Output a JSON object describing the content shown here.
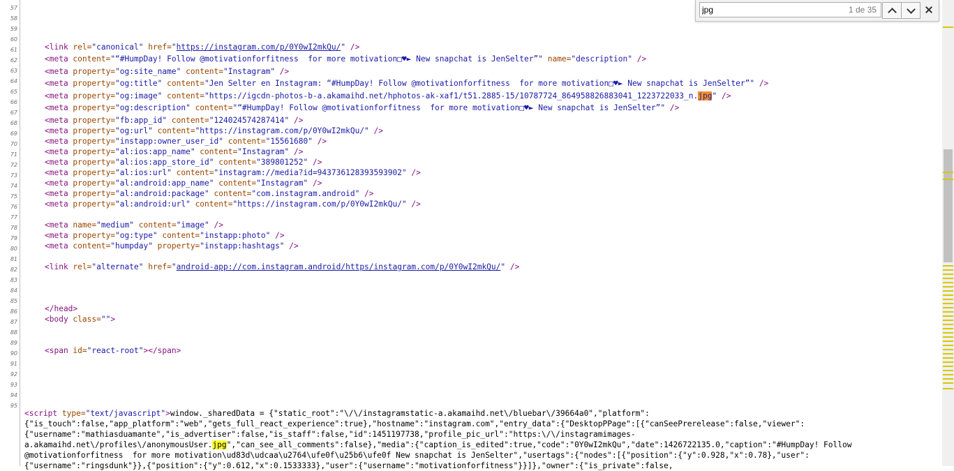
{
  "find_bar": {
    "query": "jpg",
    "count": "1 de 35"
  },
  "gutter": {
    "numbers": [
      "57",
      "58",
      "59",
      "60",
      "61",
      "62",
      "63",
      "64",
      "65",
      "66",
      "67",
      "68",
      "69",
      "70",
      "71",
      "72",
      "73",
      "74",
      "75",
      "76",
      "77",
      "78",
      "79",
      "80",
      "81",
      "82",
      "83",
      "84",
      "85",
      "86",
      "87",
      "88",
      "89",
      "90",
      "91",
      "92",
      "93",
      "94",
      "95"
    ]
  },
  "lines": {
    "l61": {
      "t1": "<link ",
      "a1": "rel=",
      "v1": "\"canonical\"",
      "a2": " href=",
      "v2a": "\"",
      "v2": "https://instagram.com/p/0Y0wI2mkQu/",
      "v2b": "\"",
      "t2": " />"
    },
    "l62": {
      "t1": "<meta ",
      "a1": "content=",
      "v1": "\"“#HumpDay! Follow @motivationforfitness  for more motivation□♥► New snapchat is JenSelter”\"",
      "a2": " name=",
      "v2": "\"description\"",
      "t2": " />"
    },
    "l63": {
      "t1": "<meta ",
      "a1": "property=",
      "v1": "\"og:site_name\"",
      "a2": " content=",
      "v2": "\"Instagram\"",
      "t2": " />"
    },
    "l64": {
      "t1": "<meta ",
      "a1": "property=",
      "v1": "\"og:title\"",
      "a2": " content=",
      "v2": "\"Jen Selter en Instagram: “#HumpDay! Follow @motivationforfitness  for more motivation□♥► New snapchat is JenSelter”\"",
      "t2": " />"
    },
    "l65": {
      "t1": "<meta ",
      "a1": "property=",
      "v1": "\"og:image\"",
      "a2": " content=",
      "v2": "\"https://igcdn-photos-b-a.akamaihd.net/hphotos-ak-xaf1/t51.2885-15/10787724_864958826883041_1223722033_n.",
      "hl": "jpg",
      "v2b": "\"",
      "t2": " />"
    },
    "l66": {
      "t1": "<meta ",
      "a1": "property=",
      "v1": "\"og:description\"",
      "a2": " content=",
      "v2": "\"“#HumpDay! Follow @motivationforfitness  for more motivation□♥► New snapchat is JenSelter”\"",
      "t2": " />"
    },
    "l67": {
      "t1": "<meta ",
      "a1": "property=",
      "v1": "\"fb:app_id\"",
      "a2": " content=",
      "v2": "\"124024574287414\"",
      "t2": " />"
    },
    "l68": {
      "t1": "<meta ",
      "a1": "property=",
      "v1": "\"og:url\"",
      "a2": " content=",
      "v2": "\"https://instagram.com/p/0Y0wI2mkQu/\"",
      "t2": " />"
    },
    "l69": {
      "t1": "<meta ",
      "a1": "property=",
      "v1": "\"instapp:owner_user_id\"",
      "a2": " content=",
      "v2": "\"15561680\"",
      "t2": " />"
    },
    "l70": {
      "t1": "<meta ",
      "a1": "property=",
      "v1": "\"al:ios:app_name\"",
      "a2": " content=",
      "v2": "\"Instagram\"",
      "t2": " />"
    },
    "l71": {
      "t1": "<meta ",
      "a1": "property=",
      "v1": "\"al:ios:app_store_id\"",
      "a2": " content=",
      "v2": "\"389801252\"",
      "t2": " />"
    },
    "l72": {
      "t1": "<meta ",
      "a1": "property=",
      "v1": "\"al:ios:url\"",
      "a2": " content=",
      "v2": "\"instagram://media?id=943736128393593902\"",
      "t2": " />"
    },
    "l73": {
      "t1": "<meta ",
      "a1": "property=",
      "v1": "\"al:android:app_name\"",
      "a2": " content=",
      "v2": "\"Instagram\"",
      "t2": " />"
    },
    "l74": {
      "t1": "<meta ",
      "a1": "property=",
      "v1": "\"al:android:package\"",
      "a2": " content=",
      "v2": "\"com.instagram.android\"",
      "t2": " />"
    },
    "l75": {
      "t1": "<meta ",
      "a1": "property=",
      "v1": "\"al:android:url\"",
      "a2": " content=",
      "v2": "\"https://instagram.com/p/0Y0wI2mkQu/\"",
      "t2": " />"
    },
    "l77": {
      "t1": "<meta ",
      "a1": "name=",
      "v1": "\"medium\"",
      "a2": " content=",
      "v2": "\"image\"",
      "t2": " />"
    },
    "l78": {
      "t1": "<meta ",
      "a1": "property=",
      "v1": "\"og:type\"",
      "a2": " content=",
      "v2": "\"instapp:photo\"",
      "t2": " />"
    },
    "l79": {
      "t1": "<meta ",
      "a1": "content=",
      "v1": "\"humpday\"",
      "a2": " property=",
      "v2": "\"instapp:hashtags\"",
      "t2": " />"
    },
    "l81": {
      "t1": "<link ",
      "a1": "rel=",
      "v1": "\"alternate\"",
      "a2": " href=",
      "v2a": "\"",
      "v2": "android-app://com.instagram.android/https/instagram.com/p/0Y0wI2mkQu/",
      "v2b": "\"",
      "t2": " />"
    },
    "l85": {
      "t1": "</head>"
    },
    "l86": {
      "t1": "<body ",
      "a1": "class=",
      "v1": "\"\"",
      "t2": ">"
    },
    "l89": {
      "t1": "<span ",
      "a1": "id=",
      "v1": "\"react-root\"",
      "t2": "></span>"
    },
    "l95": {
      "t1": "<script ",
      "a1": "type=",
      "v1": "\"text/javascript\"",
      "t2": ">",
      "js1": "window._sharedData = {\"static_root\":\"\\/\\/instagramstatic-a.akamaihd.net\\/bluebar\\/39664a0\",\"platform\":",
      "js2": "{\"is_touch\":false,\"app_platform\":\"web\",\"gets_full_react_experience\":true},\"hostname\":\"instagram.com\",\"entry_data\":{\"DesktopPPage\":[{\"canSeePrerelease\":false,\"viewer\":",
      "js3": "{\"username\":\"mathiasduamante\",\"is_advertiser\":false,\"is_staff\":false,\"id\":1451197738,\"profile_pic_url\":\"https:\\/\\/instagramimages-",
      "js4a": "a.akamaihd.net\\/profiles\\/anonymousUser.",
      "js4hl": "jpg",
      "js4b": "\",\"can_see_all_comments\":false},\"media\":{\"caption_is_edited\":true,\"code\":\"0Y0wI2mkQu\",\"date\":1426722135.0,\"caption\":\"#HumpDay! Follow",
      "js5": "@motivationforfitness  for more motivation\\ud83d\\udcaa\\u2764\\ufe0f\\u25b6\\ufe0f New snapchat is JenSelter\",\"usertags\":{\"nodes\":[{\"position\":{\"y\":0.928,\"x\":0.78},\"user\":",
      "js6": "{\"username\":\"ringsdunk\"}},{\"position\":{\"y\":0.612,\"x\":0.1533333},\"user\":{\"username\":\"motivationforfitness\"}}]},\"owner\":{\"is_private\":false,"
    }
  }
}
